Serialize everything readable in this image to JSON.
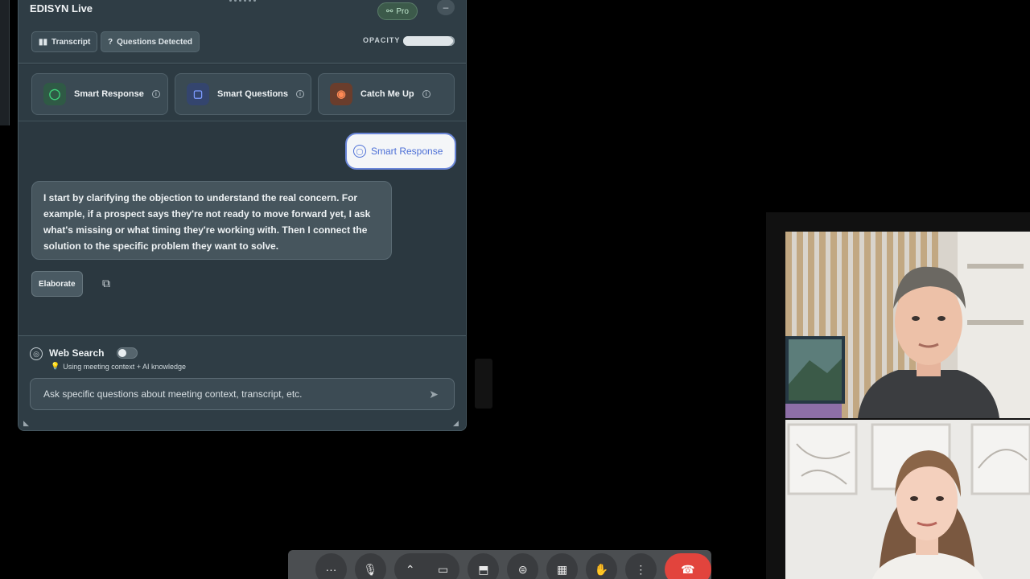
{
  "app": {
    "title": "EDISYN Live",
    "badge": "Pro"
  },
  "tabs": [
    {
      "label": "Transcript"
    },
    {
      "label": "Questions Detected"
    }
  ],
  "opacity": {
    "label": "OPACITY",
    "value": 0.95
  },
  "actions": [
    {
      "label": "Smart Response",
      "icon": "speech-bubble-icon",
      "color": "#2f9a58"
    },
    {
      "label": "Smart Questions",
      "icon": "question-bubble-icon",
      "color": "#4a6fd8"
    },
    {
      "label": "Catch Me Up",
      "icon": "rss-icon",
      "color": "#d46a3a"
    }
  ],
  "chat": {
    "user_message": "Smart Response",
    "reply": "I start by clarifying the objection to understand the real concern. For example, if a prospect says they're not ready to move forward yet, I ask what's missing or what timing they're working with. Then I connect the solution to the specific problem they want to solve.",
    "elaborate_label": "Elaborate"
  },
  "web_search": {
    "label": "Web Search",
    "enabled": false,
    "hint": "Using meeting context + AI knowledge"
  },
  "input": {
    "placeholder": "Ask specific questions about meeting context, transcript, etc."
  },
  "meeting_toolbar": {
    "more_label": "···",
    "leave_color": "#e2443d"
  }
}
